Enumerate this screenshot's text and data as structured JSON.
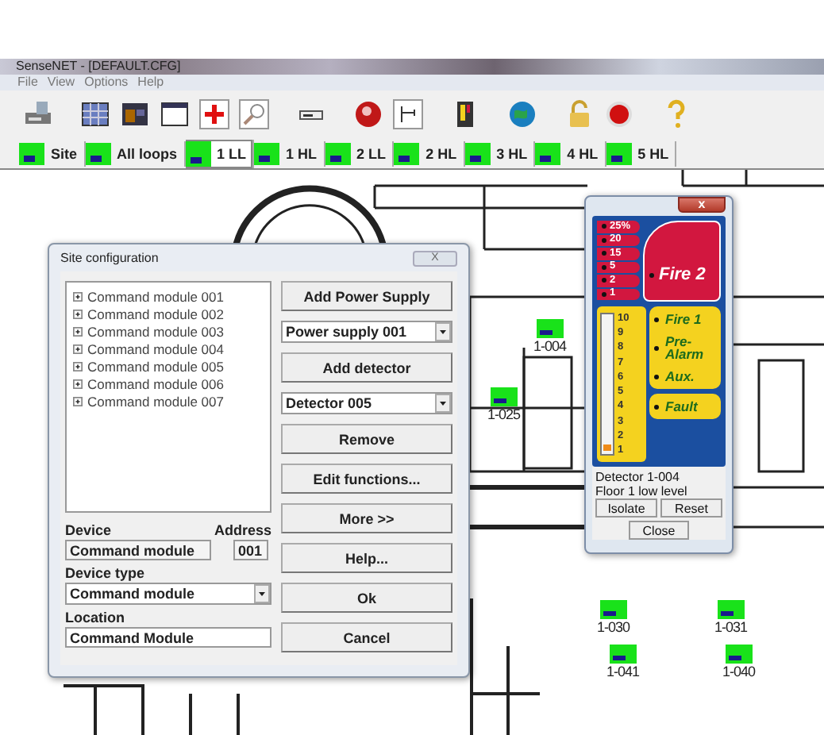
{
  "window": {
    "title": "SenseNET - [DEFAULT.CFG]"
  },
  "menu": [
    "File",
    "View",
    "Options",
    "Help"
  ],
  "loop_tabs": [
    {
      "label": "Site",
      "selected": false
    },
    {
      "label": "All loops",
      "selected": false
    },
    {
      "label": "1 LL",
      "selected": true
    },
    {
      "label": "1 HL",
      "selected": false
    },
    {
      "label": "2 LL",
      "selected": false
    },
    {
      "label": "2 HL",
      "selected": false
    },
    {
      "label": "3 HL",
      "selected": false
    },
    {
      "label": "4 HL",
      "selected": false
    },
    {
      "label": "5 HL",
      "selected": false
    }
  ],
  "floor_plan": {
    "detectors": [
      {
        "label": "1-004"
      },
      {
        "label": "1-025"
      },
      {
        "label": "1-030"
      },
      {
        "label": "1-031"
      },
      {
        "label": "1-041"
      },
      {
        "label": "1-040"
      }
    ]
  },
  "site_configuration": {
    "title": "Site configuration",
    "close": "X",
    "tree": [
      {
        "label": "Command module 001",
        "expanded": false
      },
      {
        "label": "Command module 002",
        "expanded": false
      },
      {
        "label": "Command module 003",
        "expanded": false
      },
      {
        "label": "Command module 004",
        "expanded": false
      },
      {
        "label": "Command module 005",
        "expanded": false
      },
      {
        "label": "Command module 006",
        "expanded": false
      },
      {
        "label": "Command module 007",
        "expanded": false
      }
    ],
    "device": {
      "label": "Device",
      "value": "Command module"
    },
    "address": {
      "label": "Address",
      "value": "001"
    },
    "device_type": {
      "label": "Device type",
      "value": "Command module"
    },
    "location": {
      "label": "Location",
      "value": "Command Module"
    },
    "add_power_supply": "Add Power Supply",
    "power_supply": "Power supply 001",
    "add_detector": "Add detector",
    "detector": "Detector 005",
    "buttons": [
      "Remove",
      "Edit functions...",
      "More >>",
      "Help...",
      "Ok",
      "Cancel"
    ]
  },
  "detector_panel": {
    "close": "x",
    "alarm_levels": [
      "25%",
      "20",
      "15",
      "5",
      "2",
      "1"
    ],
    "fire2": "Fire 2",
    "scale": [
      "10",
      "9",
      "8",
      "7",
      "6",
      "5",
      "4",
      "3",
      "2",
      "1"
    ],
    "level": 0.05,
    "indicators": [
      "Fire 1",
      "Pre-Alarm",
      "Aux."
    ],
    "fault": "Fault",
    "detector": "Detector 1-004",
    "location": "Floor 1 low level",
    "buttons": [
      "Isolate",
      "Reset"
    ],
    "close_button": "Close"
  }
}
